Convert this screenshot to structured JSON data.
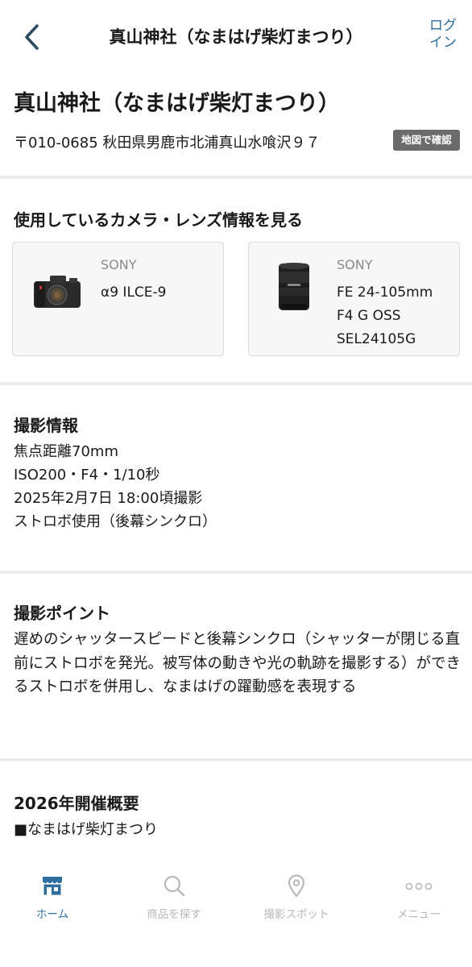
{
  "header": {
    "title": "真山神社（なまはげ柴灯まつり）",
    "login_line1": "ログ",
    "login_line2": "イン"
  },
  "place": {
    "title": "真山神社（なまはげ柴灯まつり）",
    "address": "〒010-0685 秋田県男鹿市北浦真山水喰沢９７",
    "map_button": "地図で確認"
  },
  "gear": {
    "heading": "使用しているカメラ・レンズ情報を見る",
    "camera": {
      "brand": "SONY",
      "model_lines": [
        "α9 ILCE-9"
      ]
    },
    "lens": {
      "brand": "SONY",
      "model_lines": [
        "FE 24-105mm",
        "F4 G OSS",
        "SEL24105G"
      ]
    }
  },
  "shooting_info": {
    "heading": "撮影情報",
    "lines": [
      "焦点距離70mm",
      "ISO200・F4・1/10秒",
      "2025年2月7日 18:00頃撮影",
      "ストロボ使用（後幕シンクロ）"
    ]
  },
  "shooting_point": {
    "heading": "撮影ポイント",
    "text": "遅めのシャッタースピードと後幕シンクロ（シャッターが閉じる直前にストロボを発光。被写体の動きや光の軌跡を撮影する）ができるストロボを併用し、なまはげの躍動感を表現する"
  },
  "event": {
    "heading": "2026年開催概要",
    "line": "■なまはげ柴灯まつり"
  },
  "tabs": [
    {
      "label": "ホーム",
      "icon": "store-icon",
      "active": true
    },
    {
      "label": "商品を探す",
      "icon": "search-icon",
      "active": false
    },
    {
      "label": "撮影スポット",
      "icon": "map-pin-icon",
      "active": false
    },
    {
      "label": "メニュー",
      "icon": "more-icon",
      "active": false
    }
  ],
  "colors": {
    "accent": "#2f6f9f",
    "inactive": "#b8b8b8",
    "map_button_bg": "#6b6b6b"
  }
}
